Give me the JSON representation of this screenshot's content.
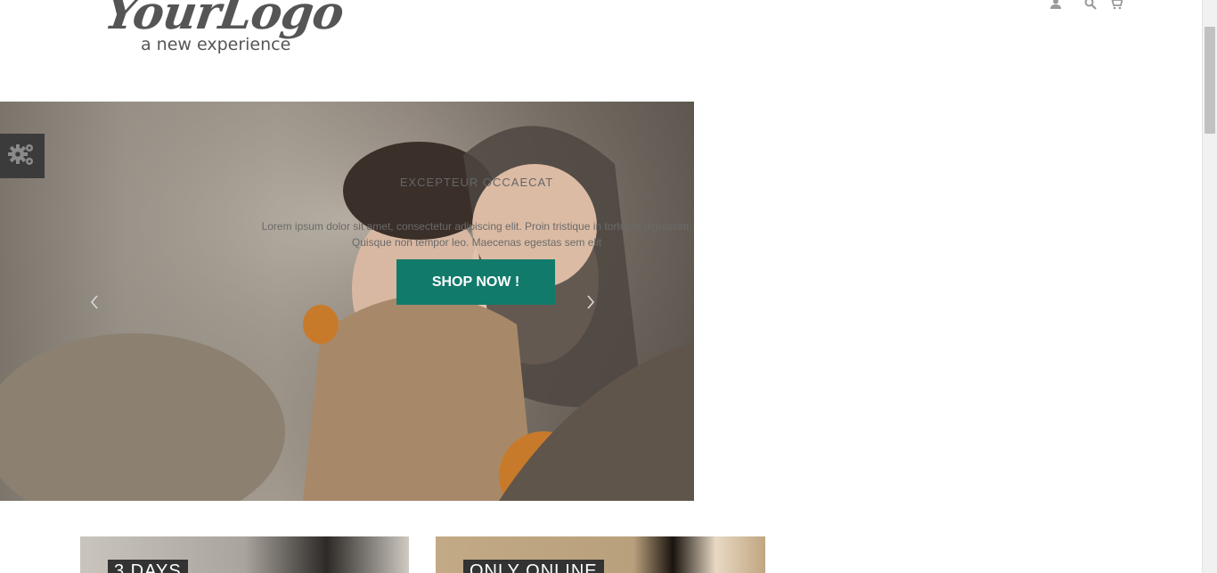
{
  "logo": {
    "main": "YourLogo",
    "tagline": "a new experience"
  },
  "header": {
    "icons": [
      "user-icon",
      "search-icon",
      "cart-icon"
    ]
  },
  "slider": {
    "title": "EXCEPTEUR OCCAECAT",
    "text": "Lorem ipsum dolor sit amet, consectetur adipiscing elit. Proin tristique in tortor et dignissim. Quisque non tempor leo. Maecenas egestas sem elit",
    "button_label": "SHOP NOW !",
    "button_color": "#117a6b"
  },
  "banners": [
    {
      "label": "3 DAYS"
    },
    {
      "label": "ONLY ONLINE"
    }
  ],
  "colors": {
    "accent": "#117a6b",
    "settings_tab": "#3b3b3b"
  }
}
